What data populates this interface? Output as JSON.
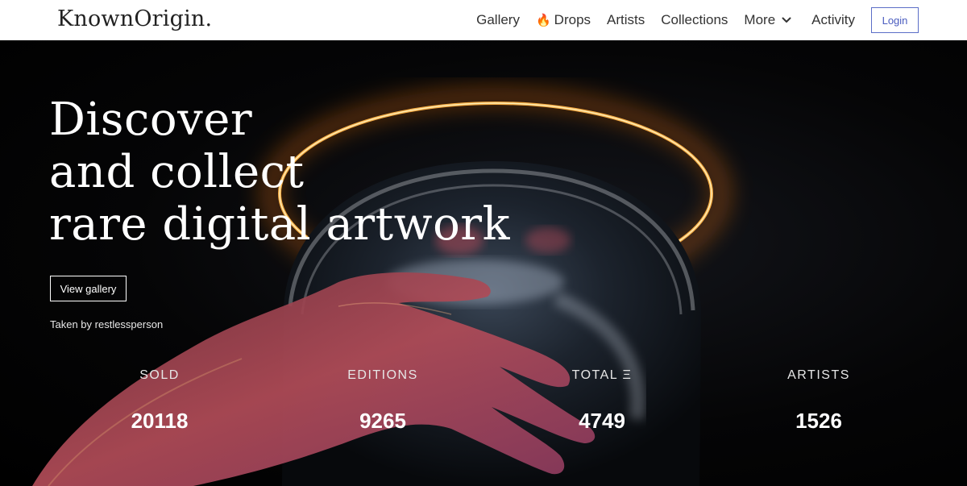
{
  "header": {
    "logo": "KnownOrigin.",
    "nav": {
      "gallery": "Gallery",
      "drops_icon": "🔥",
      "drops": "Drops",
      "artists": "Artists",
      "collections": "Collections",
      "more": "More",
      "activity": "Activity"
    },
    "login_label": "Login"
  },
  "hero": {
    "headline": [
      "Discover",
      "and collect",
      "rare digital artwork"
    ],
    "cta_label": "View gallery",
    "credit": "Taken by restlessperson",
    "stats": [
      {
        "label": "SOLD",
        "value": "20118"
      },
      {
        "label": "EDITIONS",
        "value": "9265"
      },
      {
        "label": "TOTAL Ξ",
        "value": "4749"
      },
      {
        "label": "ARTISTS",
        "value": "1526"
      }
    ]
  },
  "colors": {
    "accent": "#4a5cbf",
    "halo": "#f5a623",
    "hand": "#c0525a"
  },
  "icons": {
    "drops": "fire-icon",
    "more": "chevron-down-icon"
  }
}
